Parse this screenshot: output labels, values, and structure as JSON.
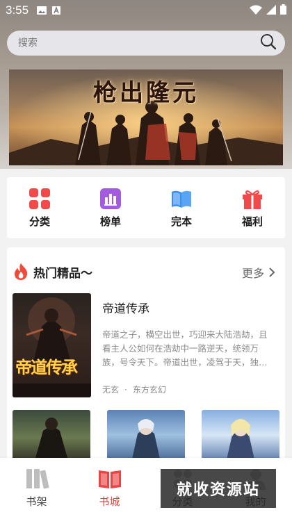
{
  "status_bar": {
    "time": "3:55"
  },
  "search": {
    "placeholder": "搜索"
  },
  "banner": {
    "title": "枪出隆元"
  },
  "categories": [
    {
      "label": "分类",
      "icon": "grid-icon",
      "color": "#f04a4a"
    },
    {
      "label": "榜单",
      "icon": "chart-icon",
      "color": "#a35be0"
    },
    {
      "label": "完本",
      "icon": "book-open-icon",
      "color": "#3a8ef0"
    },
    {
      "label": "福利",
      "icon": "gift-icon",
      "color": "#f04a4a"
    }
  ],
  "hot_section": {
    "title": "热门精品～",
    "more_label": "更多",
    "featured": {
      "title": "帝道传承",
      "description": "帝道之子，横空出世，巧迎来大陆浩劫，且看主人公如何在浩劫中一路逆天，统领万族，号令天下。帝道出世，凌驾于天，独…",
      "author": "无玄",
      "dot": "·",
      "genre": "东方玄幻",
      "cover_text": "帝道传承"
    }
  },
  "bottom_nav": [
    {
      "label": "书架",
      "icon": "bookshelf-icon",
      "active": false
    },
    {
      "label": "书城",
      "icon": "book-store-icon",
      "active": true
    },
    {
      "label": "分类",
      "icon": "category-icon",
      "active": false
    },
    {
      "label": "我的",
      "icon": "profile-icon",
      "active": false
    }
  ],
  "watermark": "就收资源站",
  "colors": {
    "accent": "#e84545",
    "desc_text": "#8a8a8a"
  }
}
